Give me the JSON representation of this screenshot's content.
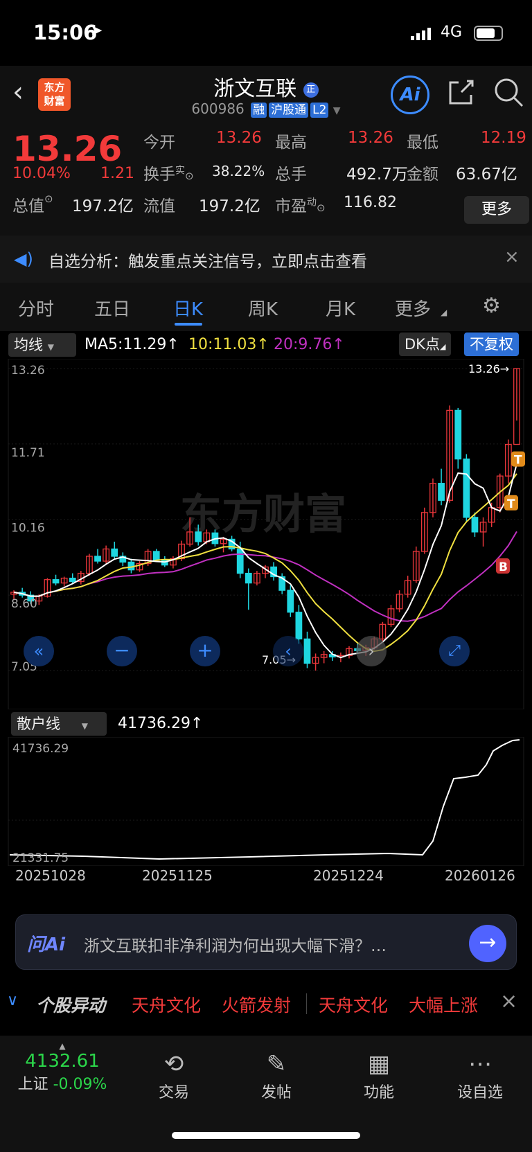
{
  "status_bar": {
    "time": "15:06",
    "network": "4G"
  },
  "header": {
    "title": "浙文互联",
    "code": "600986",
    "tags": [
      "融",
      "沪股通",
      "L2"
    ],
    "logo_text_1": "东方",
    "logo_text_2": "财富",
    "ai_label": "Ai"
  },
  "quote": {
    "price": "13.26",
    "change_pct": "10.04%",
    "change": "1.21",
    "open_label": "今开",
    "open": "13.26",
    "high_label": "最高",
    "high": "13.26",
    "low_label": "最低",
    "low": "12.19",
    "turnover_label": "换手",
    "turnover_sup": "实",
    "turnover": "38.22%",
    "volume_label": "总手",
    "volume": "492.7万",
    "amount_label": "金额",
    "amount": "63.67亿",
    "mktcap_label": "总值",
    "mktcap": "197.2亿",
    "float_label": "流值",
    "float": "197.2亿",
    "pe_label": "市盈",
    "pe_sup": "动",
    "pe": "116.82",
    "more_label": "更多"
  },
  "banner": {
    "text": "自选分析：触发重点关注信号，立即点击查看"
  },
  "tabs": [
    {
      "label": "分时"
    },
    {
      "label": "五日"
    },
    {
      "label": "日K"
    },
    {
      "label": "周K"
    },
    {
      "label": "月K"
    },
    {
      "label": "更多"
    }
  ],
  "indicator_bar": {
    "type": "均线",
    "ma5": "MA5:11.29↑",
    "ma10": "10:11.03↑",
    "ma20": "20:9.76↑",
    "dk": "DK点",
    "fq": "不复权"
  },
  "chart_data": {
    "type": "candlestick",
    "y_labels": [
      "13.26",
      "11.71",
      "10.16",
      "8.60",
      "7.05"
    ],
    "ylim": [
      7.05,
      13.26
    ],
    "max_marker": "13.26→",
    "min_marker": "7.05→",
    "watermark": "东方财富",
    "markers": [
      "T",
      "T",
      "B"
    ],
    "ma_colors": {
      "ma5": "#ffffff",
      "ma10": "#f0e040",
      "ma20": "#c030c0"
    },
    "up_color": "#e8363a",
    "down_color": "#1fd6e0",
    "candles": [
      [
        8.62,
        8.7,
        8.5,
        8.66
      ],
      [
        8.66,
        8.75,
        8.55,
        8.6
      ],
      [
        8.6,
        8.68,
        8.42,
        8.48
      ],
      [
        8.48,
        8.62,
        8.4,
        8.58
      ],
      [
        8.58,
        8.95,
        8.55,
        8.92
      ],
      [
        8.92,
        9.02,
        8.8,
        8.85
      ],
      [
        8.85,
        8.98,
        8.78,
        8.95
      ],
      [
        8.95,
        9.05,
        8.85,
        8.88
      ],
      [
        8.88,
        9.1,
        8.82,
        9.05
      ],
      [
        9.05,
        9.45,
        9.0,
        9.4
      ],
      [
        9.4,
        9.55,
        9.25,
        9.3
      ],
      [
        9.3,
        9.62,
        9.25,
        9.55
      ],
      [
        9.55,
        9.7,
        9.35,
        9.4
      ],
      [
        9.4,
        9.48,
        9.2,
        9.28
      ],
      [
        9.28,
        9.35,
        9.05,
        9.12
      ],
      [
        9.12,
        9.3,
        9.08,
        9.25
      ],
      [
        9.25,
        9.55,
        9.2,
        9.5
      ],
      [
        9.5,
        9.55,
        9.28,
        9.32
      ],
      [
        9.32,
        9.4,
        9.18,
        9.22
      ],
      [
        9.22,
        9.4,
        9.15,
        9.35
      ],
      [
        9.35,
        9.72,
        9.3,
        9.65
      ],
      [
        9.65,
        10.2,
        9.6,
        9.9
      ],
      [
        9.9,
        10.05,
        9.62,
        9.7
      ],
      [
        9.7,
        9.95,
        9.65,
        9.88
      ],
      [
        9.88,
        9.95,
        9.6,
        9.66
      ],
      [
        9.66,
        9.8,
        9.48,
        9.75
      ],
      [
        9.75,
        9.82,
        9.5,
        9.55
      ],
      [
        9.55,
        9.7,
        8.95,
        9.05
      ],
      [
        9.05,
        9.15,
        8.3,
        8.85
      ],
      [
        8.85,
        9.1,
        8.8,
        9.05
      ],
      [
        9.05,
        9.22,
        8.95,
        9.18
      ],
      [
        9.18,
        9.28,
        8.9,
        8.98
      ],
      [
        8.98,
        9.05,
        8.62,
        8.7
      ],
      [
        8.7,
        8.8,
        8.15,
        8.25
      ],
      [
        8.25,
        8.4,
        7.6,
        7.7
      ],
      [
        7.7,
        7.85,
        7.1,
        7.2
      ],
      [
        7.2,
        7.4,
        7.05,
        7.32
      ],
      [
        7.32,
        7.45,
        7.2,
        7.38
      ],
      [
        7.38,
        7.45,
        7.25,
        7.33
      ],
      [
        7.33,
        7.42,
        7.22,
        7.36
      ],
      [
        7.36,
        7.55,
        7.3,
        7.5
      ],
      [
        7.5,
        7.6,
        7.4,
        7.46
      ],
      [
        7.46,
        7.58,
        7.35,
        7.52
      ],
      [
        7.52,
        7.75,
        7.48,
        7.7
      ],
      [
        7.7,
        8.05,
        7.65,
        8.0
      ],
      [
        8.0,
        8.4,
        7.95,
        8.32
      ],
      [
        8.32,
        8.7,
        8.25,
        8.62
      ],
      [
        8.62,
        9.0,
        8.55,
        8.9
      ],
      [
        8.9,
        9.6,
        8.85,
        9.5
      ],
      [
        9.5,
        10.4,
        9.45,
        10.3
      ],
      [
        10.3,
        11.0,
        10.2,
        10.9
      ],
      [
        10.9,
        11.2,
        10.45,
        10.55
      ],
      [
        10.55,
        12.5,
        10.5,
        12.4
      ],
      [
        12.4,
        12.45,
        11.2,
        11.4
      ],
      [
        11.4,
        11.5,
        10.1,
        10.2
      ],
      [
        10.2,
        10.3,
        9.8,
        9.9
      ],
      [
        9.9,
        10.2,
        9.6,
        10.1
      ],
      [
        10.1,
        10.5,
        10.0,
        10.4
      ],
      [
        10.4,
        11.1,
        10.3,
        11.05
      ],
      [
        11.05,
        11.8,
        10.9,
        11.7
      ],
      [
        11.7,
        13.26,
        12.19,
        13.26
      ]
    ]
  },
  "sub_indicator": {
    "type": "散户线",
    "value": "41736.29↑",
    "max_label": "41736.29",
    "min_label": "21331.75"
  },
  "date_labels": [
    "20251028",
    "20251125",
    "20251224",
    "20260126"
  ],
  "ask_ai": {
    "brand": "问Ai",
    "question": "浙文互联扣非净利润为何出现大幅下滑？…"
  },
  "ticker": {
    "label": "个股异动",
    "items": [
      "天舟文化",
      "火箭发射",
      "天舟文化",
      "大幅上涨"
    ]
  },
  "nav": {
    "index_value": "4132.61",
    "index_name": "上证",
    "index_change": "-0.09%",
    "items": [
      {
        "label": "交易"
      },
      {
        "label": "发帖"
      },
      {
        "label": "功能"
      },
      {
        "label": "设自选"
      }
    ]
  }
}
